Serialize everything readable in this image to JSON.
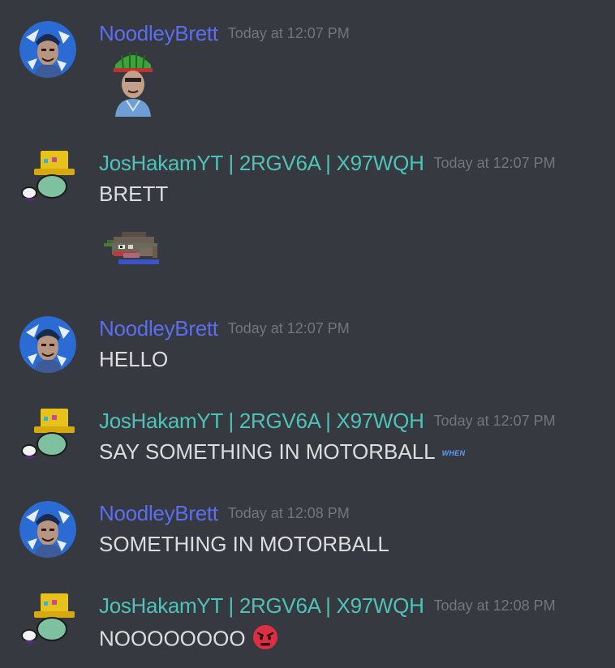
{
  "messages": [
    {
      "author": "NoodleyBrett",
      "timestamp": "Today at 12:07 PM",
      "text": "",
      "attachment": "pepe-brett-helmet-emoji"
    },
    {
      "author": "JosHakamYT | 2RGV6A | X97WQH",
      "timestamp": "Today at 12:07 PM",
      "text": "BRETT",
      "attachment": "pixel-frog-emoji"
    },
    {
      "author": "NoodleyBrett",
      "timestamp": "Today at 12:07 PM",
      "text": "HELLO"
    },
    {
      "author": "JosHakamYT | 2RGV6A | X97WQH",
      "timestamp": "Today at 12:07 PM",
      "text": "SAY SOMETHING IN MOTORBALL",
      "inline_emote": "when-emote",
      "inline_emote_text": "WHEN"
    },
    {
      "author": "NoodleyBrett",
      "timestamp": "Today at 12:08 PM",
      "text": "SOMETHING IN MOTORBALL"
    },
    {
      "author": "JosHakamYT | 2RGV6A | X97WQH",
      "timestamp": "Today at 12:08 PM",
      "text": "NOOOOOOOO",
      "inline_emote": "angry-face-emoji"
    }
  ],
  "colors": {
    "background": "#36393f",
    "brett_name": "#5b6ef0",
    "jos_name": "#4fc3b8",
    "timestamp": "#72767d",
    "text": "#dcddde"
  }
}
